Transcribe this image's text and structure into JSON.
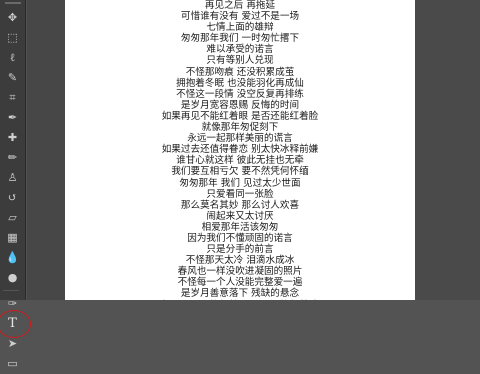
{
  "toolbar": {
    "tools": [
      {
        "name": "move-tool-icon",
        "glyph": "✥"
      },
      {
        "name": "marquee-tool-icon",
        "glyph": "⬚"
      },
      {
        "name": "lasso-tool-icon",
        "glyph": "ℓ"
      },
      {
        "name": "quick-select-tool-icon",
        "glyph": "✎"
      },
      {
        "name": "crop-tool-icon",
        "glyph": "⌗"
      },
      {
        "name": "eyedropper-tool-icon",
        "glyph": "✒"
      },
      {
        "name": "healing-brush-tool-icon",
        "glyph": "✚"
      },
      {
        "name": "brush-tool-icon",
        "glyph": "✏"
      },
      {
        "name": "clone-stamp-tool-icon",
        "glyph": "♙"
      },
      {
        "name": "history-brush-tool-icon",
        "glyph": "↺"
      },
      {
        "name": "eraser-tool-icon",
        "glyph": "▱"
      },
      {
        "name": "gradient-tool-icon",
        "glyph": "▦"
      },
      {
        "name": "blur-tool-icon",
        "glyph": "💧"
      },
      {
        "name": "dodge-tool-icon",
        "glyph": "●"
      },
      {
        "name": "pen-tool-icon",
        "glyph": "✑"
      },
      {
        "name": "type-tool-icon",
        "glyph": "T"
      },
      {
        "name": "path-selection-tool-icon",
        "glyph": "➤"
      },
      {
        "name": "shape-tool-icon",
        "glyph": "▭"
      }
    ],
    "highlighted_tool": "type-tool-icon",
    "highlight_color": "#d11a1a"
  },
  "document": {
    "lines": [
      "再见之后 再拖延",
      "可惜谁有没有 爱过不是一场",
      "七情上面的雄辩",
      "匆匆那年我们 一时匆忙撂下",
      "难以承受的诺言",
      "只有等别人兑现",
      "不怪那吻痕 还没积累成茧",
      "拥抱着冬眠 也没能羽化再成仙",
      "不怪这一段情 没空反复再排练",
      "是岁月宽容恩赐 反悔的时间",
      "如果再见不能红着眼 是否还能红着脸",
      "就像那年匆促刻下",
      "永远一起那样美丽的谎言",
      "如果过去还值得眷恋 别太快冰释前嫌",
      "谁甘心就这样 彼此无挂也无牵",
      "我们要互相亏欠 要不然凭何怀缅",
      "匆匆那年 我们 见过太少世面",
      "只爱看同一张脸",
      "那么莫名其妙 那么讨人欢喜",
      "闹起来又太讨厌",
      "相爱那年活该匆匆",
      "因为我们不懂顽固的诺言",
      "只是分手的前言",
      "不怪那天太冷 泪滴水成冰",
      "春风也一样没吹进凝固的照片",
      "不怪每一个人没能完整爱一遍",
      "是岁月善意落下 残缺的悬念",
      "如果再见不能红着眼 是否还能红着脸",
      "就像那年匆促刻下",
      "永远一起那样美丽的谎言"
    ]
  }
}
